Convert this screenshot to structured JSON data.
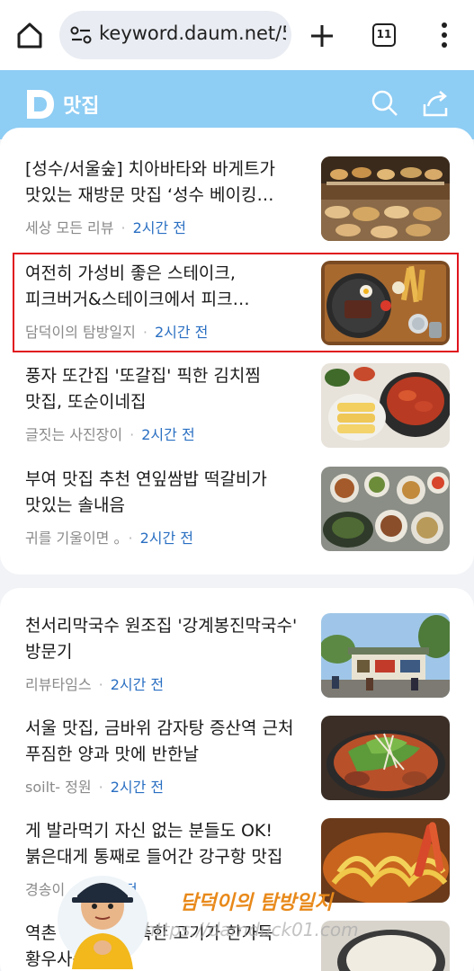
{
  "browser": {
    "url": "keyword.daum.net/5",
    "tab_count": "11"
  },
  "header": {
    "title": "맛집",
    "brand_color": "#8ecdf4"
  },
  "articles_group1": [
    {
      "title": "[성수/서울숲] 치아바타와 바게트가 맛있는 재방문 맛집 ‘성수 베이킹 스튜디오’",
      "source": "세상 모든 리뷰",
      "time": "2시간 전"
    },
    {
      "title": "여전히 가성비 좋은 스테이크, 피크버거&스테이크에서 피크 시그니처 세트",
      "source": "담덕이의 탐방일지",
      "time": "2시간 전"
    },
    {
      "title": "풍자 또간집 '또갈집' 픽한 김치찜 맛집, 또순이네집",
      "source": "글짓는 사진장이",
      "time": "2시간 전"
    },
    {
      "title": "부여 맛집 추천 연잎쌈밥 떡갈비가 맛있는 솔내음",
      "source": "귀를 기울이면 。",
      "time": "2시간 전"
    }
  ],
  "articles_group2": [
    {
      "title": "천서리막국수 원조집 '강계봉진막국수' 방문기",
      "source": "리뷰타임스",
      "time": "2시간 전"
    },
    {
      "title": "서울 맛집, 금바위 감자탕 증산역 근처 푸짐한 양과 맛에 반한날",
      "source": "soilt- 정원",
      "time": "2시간 전"
    },
    {
      "title": "게 발라먹기 자신 없는 분들도 OK! 붉은대게 통째로 들어간 강구항 맛집",
      "source": "경송이",
      "time": "3시간 전"
    },
    {
      "title": "역촌 ... 럽고 촉촉한 고기가 한가득 황우사순대국",
      "source": "",
      "time": ""
    }
  ],
  "watermark": {
    "blog_name": "담덕이의 탐방일지",
    "blog_url": "https://damduck01.com"
  }
}
